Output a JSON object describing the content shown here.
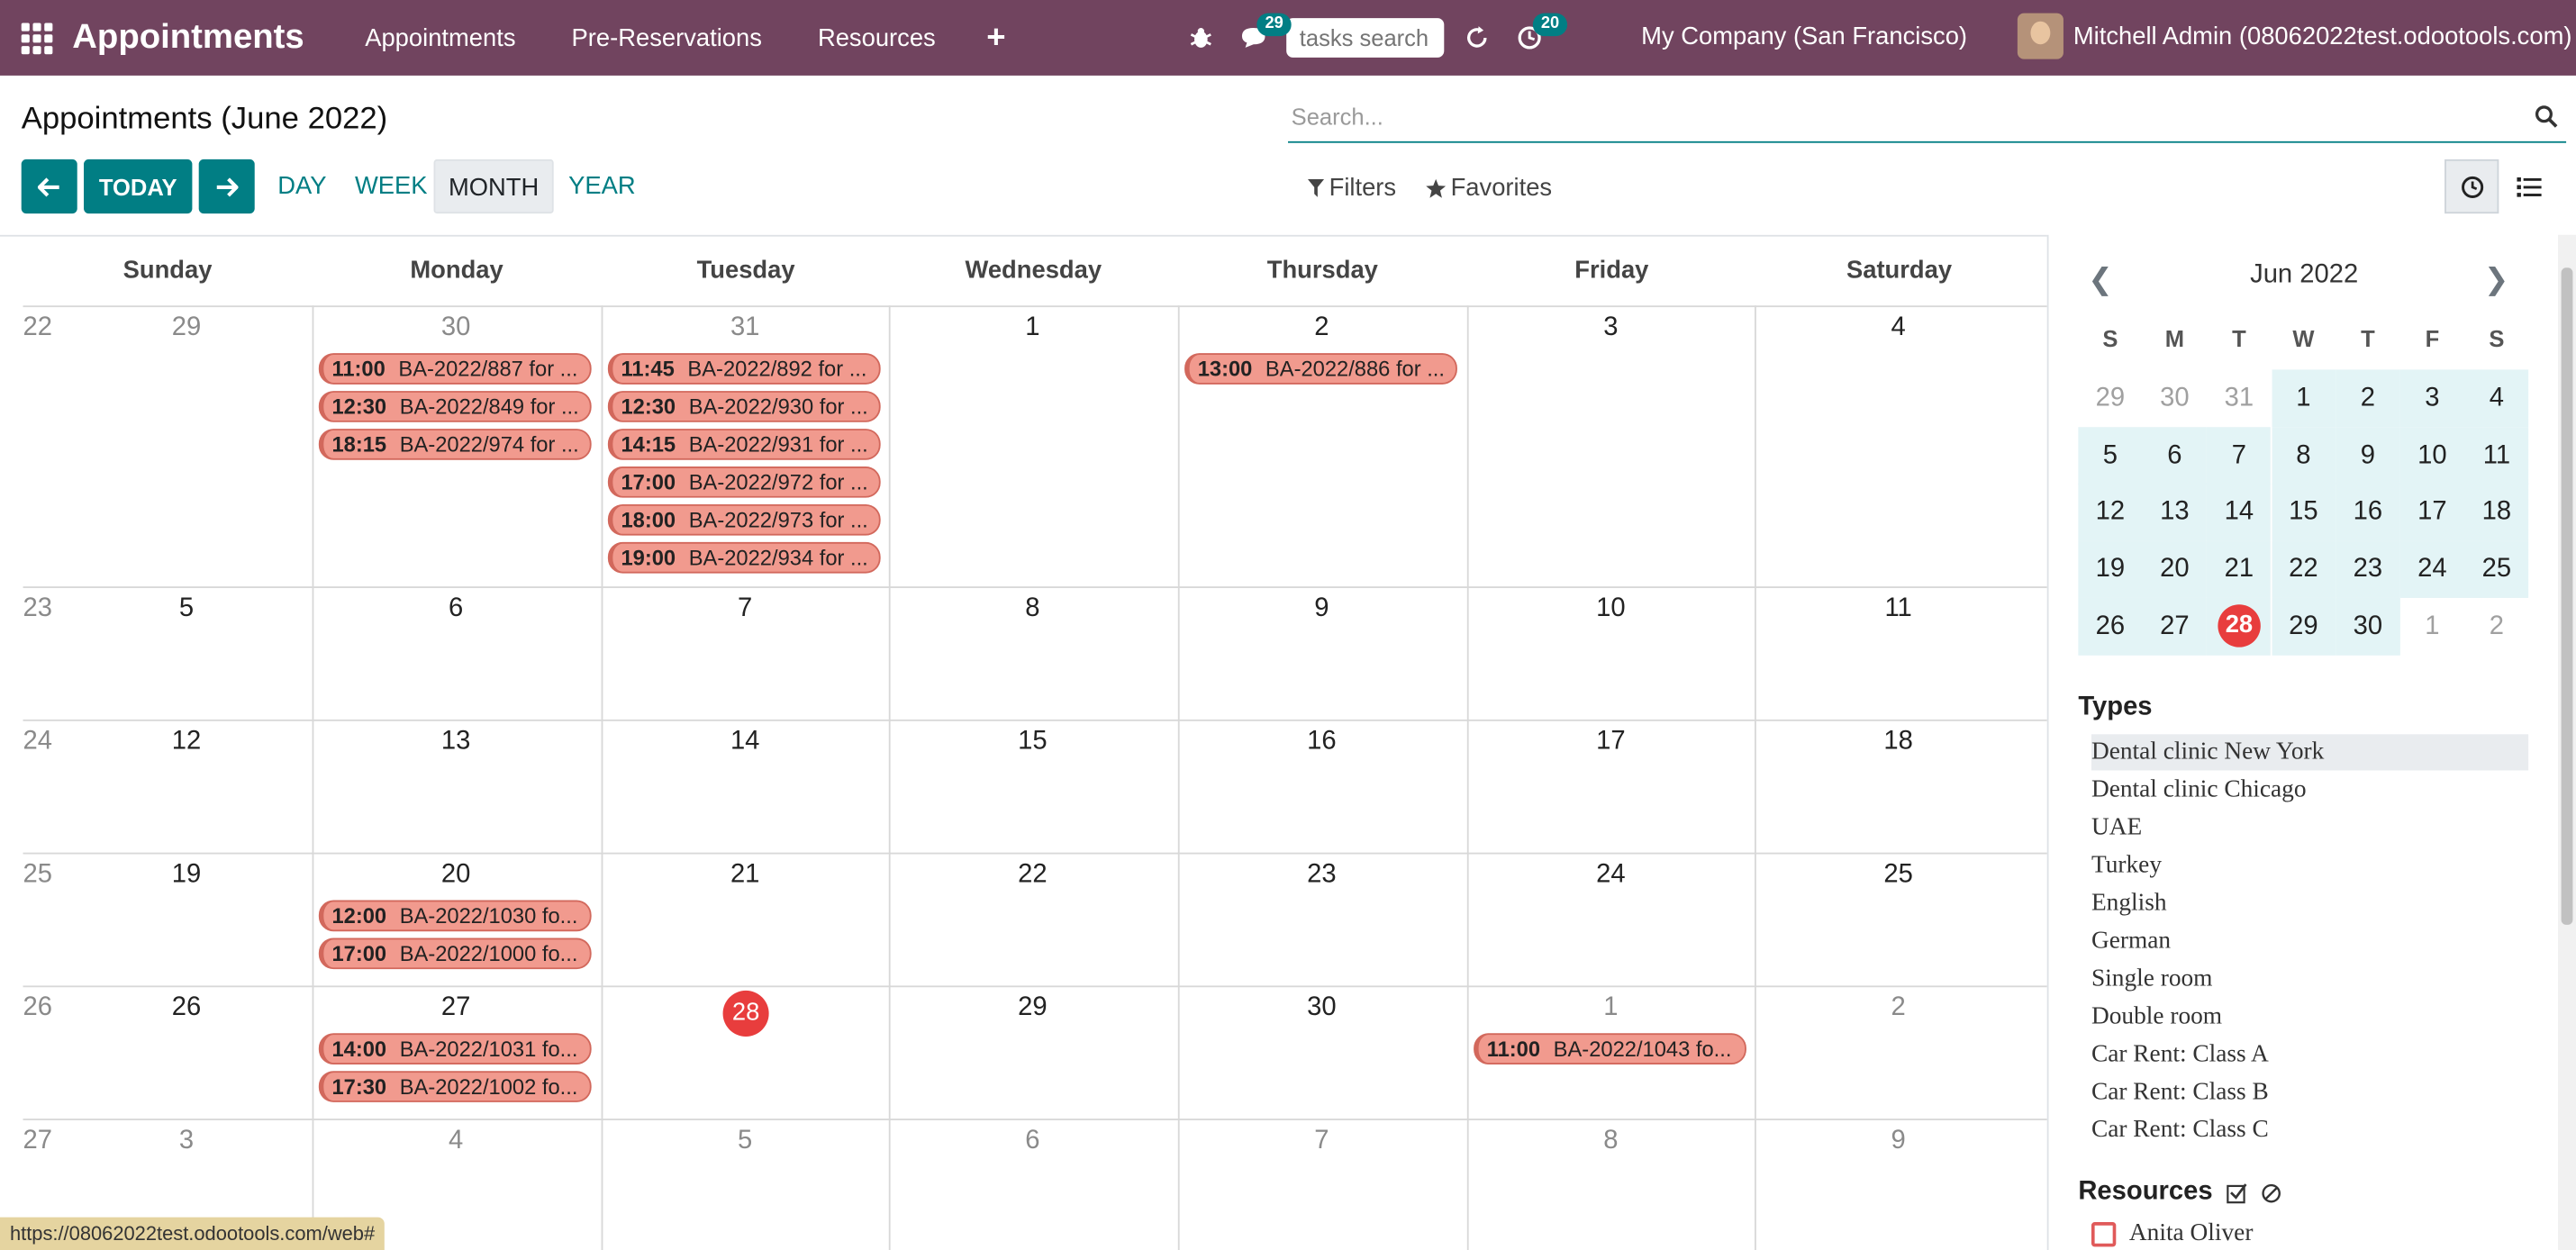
{
  "navbar": {
    "app_title": "Appointments",
    "menu": [
      "Appointments",
      "Pre-Reservations",
      "Resources"
    ],
    "messages_count": "29",
    "tasks_search_placeholder": "tasks search",
    "activities_count": "20",
    "company": "My Company (San Francisco)",
    "user": "Mitchell Admin (08062022test.odootools.com)"
  },
  "control": {
    "title": "Appointments (June 2022)",
    "search_placeholder": "Search...",
    "today_label": "TODAY",
    "scales": [
      "DAY",
      "WEEK",
      "MONTH",
      "YEAR"
    ],
    "active_scale": "MONTH",
    "filters_label": "Filters",
    "favorites_label": "Favorites"
  },
  "calendar": {
    "days": [
      "Sunday",
      "Monday",
      "Tuesday",
      "Wednesday",
      "Thursday",
      "Friday",
      "Saturday"
    ],
    "weeks": [
      {
        "num": "22",
        "dates": [
          "29",
          "30",
          "31",
          "1",
          "2",
          "3",
          "4"
        ],
        "out": [
          true,
          true,
          true,
          false,
          false,
          false,
          false
        ]
      },
      {
        "num": "23",
        "dates": [
          "5",
          "6",
          "7",
          "8",
          "9",
          "10",
          "11"
        ],
        "out": [
          false,
          false,
          false,
          false,
          false,
          false,
          false
        ]
      },
      {
        "num": "24",
        "dates": [
          "12",
          "13",
          "14",
          "15",
          "16",
          "17",
          "18"
        ],
        "out": [
          false,
          false,
          false,
          false,
          false,
          false,
          false
        ]
      },
      {
        "num": "25",
        "dates": [
          "19",
          "20",
          "21",
          "22",
          "23",
          "24",
          "25"
        ],
        "out": [
          false,
          false,
          false,
          false,
          false,
          false,
          false
        ]
      },
      {
        "num": "26",
        "dates": [
          "26",
          "27",
          "28",
          "29",
          "30",
          "1",
          "2"
        ],
        "out": [
          false,
          false,
          false,
          false,
          false,
          true,
          true
        ]
      },
      {
        "num": "27",
        "dates": [
          "3",
          "4",
          "5",
          "6",
          "7",
          "8",
          "9"
        ],
        "out": [
          true,
          true,
          true,
          true,
          true,
          true,
          true
        ]
      }
    ],
    "today": "28",
    "events": [
      {
        "week": 0,
        "day": 1,
        "slot": 0,
        "time": "11:00",
        "title": "BA-2022/887 for ..."
      },
      {
        "week": 0,
        "day": 1,
        "slot": 1,
        "time": "12:30",
        "title": "BA-2022/849 for ..."
      },
      {
        "week": 0,
        "day": 1,
        "slot": 2,
        "time": "18:15",
        "title": "BA-2022/974 for ..."
      },
      {
        "week": 0,
        "day": 2,
        "slot": 0,
        "time": "11:45",
        "title": "BA-2022/892 for ..."
      },
      {
        "week": 0,
        "day": 2,
        "slot": 1,
        "time": "12:30",
        "title": "BA-2022/930 for ..."
      },
      {
        "week": 0,
        "day": 2,
        "slot": 2,
        "time": "14:15",
        "title": "BA-2022/931 for ..."
      },
      {
        "week": 0,
        "day": 2,
        "slot": 3,
        "time": "17:00",
        "title": "BA-2022/972 for ..."
      },
      {
        "week": 0,
        "day": 2,
        "slot": 4,
        "time": "18:00",
        "title": "BA-2022/973 for ..."
      },
      {
        "week": 0,
        "day": 2,
        "slot": 5,
        "time": "19:00",
        "title": "BA-2022/934 for ..."
      },
      {
        "week": 0,
        "day": 4,
        "slot": 0,
        "time": "13:00",
        "title": "BA-2022/886 for ..."
      },
      {
        "week": 3,
        "day": 1,
        "slot": 0,
        "time": "12:00",
        "title": "BA-2022/1030 fo..."
      },
      {
        "week": 3,
        "day": 1,
        "slot": 1,
        "time": "17:00",
        "title": "BA-2022/1000 fo..."
      },
      {
        "week": 4,
        "day": 1,
        "slot": 0,
        "time": "14:00",
        "title": "BA-2022/1031 fo..."
      },
      {
        "week": 4,
        "day": 1,
        "slot": 1,
        "time": "17:30",
        "title": "BA-2022/1002 fo..."
      },
      {
        "week": 4,
        "day": 5,
        "slot": 0,
        "time": "11:00",
        "title": "BA-2022/1043 fo..."
      }
    ]
  },
  "mini_calendar": {
    "title": "Jun 2022",
    "dow": [
      "S",
      "M",
      "T",
      "W",
      "T",
      "F",
      "S"
    ],
    "rows": [
      [
        "29",
        "30",
        "31",
        "1",
        "2",
        "3",
        "4"
      ],
      [
        "5",
        "6",
        "7",
        "8",
        "9",
        "10",
        "11"
      ],
      [
        "12",
        "13",
        "14",
        "15",
        "16",
        "17",
        "18"
      ],
      [
        "19",
        "20",
        "21",
        "22",
        "23",
        "24",
        "25"
      ],
      [
        "26",
        "27",
        "28",
        "29",
        "30",
        "1",
        "2"
      ]
    ]
  },
  "types": {
    "title": "Types",
    "items": [
      "Dental clinic New York",
      "Dental clinic Chicago",
      "UAE",
      "Turkey",
      "English",
      "German",
      "Single room",
      "Double room",
      "Car Rent: Class A",
      "Car Rent: Class B",
      "Car Rent: Class C"
    ]
  },
  "resources": {
    "title": "Resources",
    "items": [
      "Anita Oliver"
    ]
  },
  "status_url": "https://08062022test.odootools.com/web#"
}
